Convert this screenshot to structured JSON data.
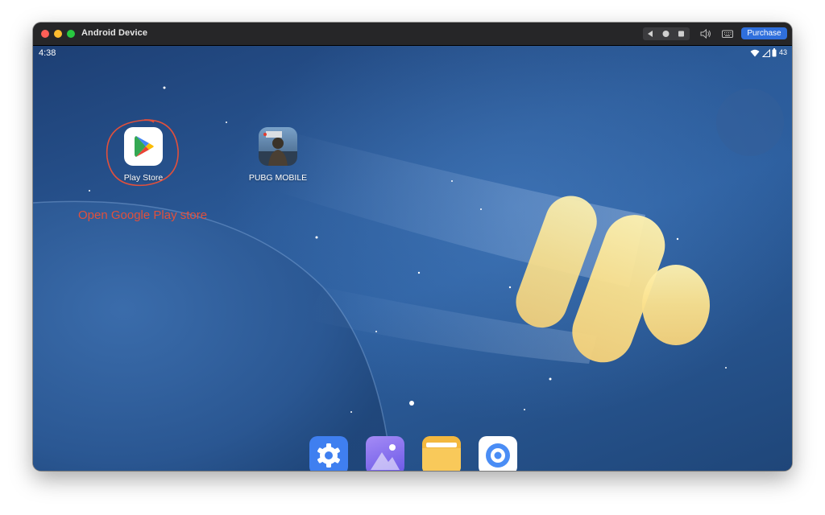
{
  "window": {
    "title": "Android Device",
    "purchase_label": "Purchase"
  },
  "status_bar": {
    "time": "4:38",
    "battery": "43"
  },
  "home": {
    "apps": [
      {
        "label": "Play Store",
        "icon": "google-play-icon"
      },
      {
        "label": "PUBG MOBILE",
        "icon": "pubg-mobile-icon"
      }
    ],
    "annotation": "Open Google Play store",
    "dock": [
      {
        "icon": "settings-icon"
      },
      {
        "icon": "gallery-icon"
      },
      {
        "icon": "files-icon"
      },
      {
        "icon": "browser-icon"
      }
    ]
  },
  "colors": {
    "annotation_red": "#e2503b",
    "purchase_blue": "#2f6fdc",
    "titlebar": "#262628"
  }
}
